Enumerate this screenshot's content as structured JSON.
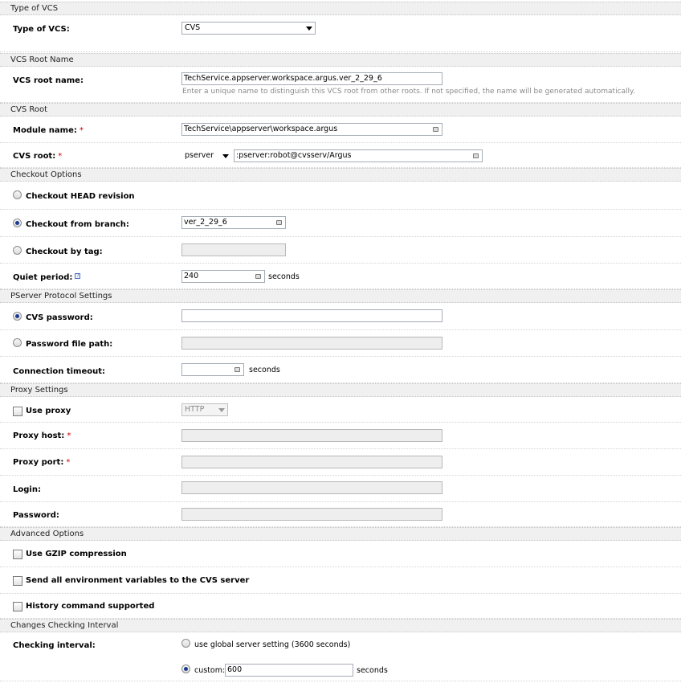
{
  "sections": {
    "type_of_vcs": "Type of VCS",
    "vcs_root_name": "VCS Root Name",
    "cvs_root": "CVS Root",
    "checkout_options": "Checkout Options",
    "pserver": "PServer Protocol Settings",
    "proxy": "Proxy Settings",
    "advanced": "Advanced Options",
    "changes": "Changes Checking Interval"
  },
  "type_of_vcs": {
    "label": "Type of VCS:",
    "value": "CVS"
  },
  "vcs_root_name": {
    "label": "VCS root name:",
    "value": "TechService.appserver.workspace.argus.ver_2_29_6",
    "note": "Enter a unique name to distinguish this VCS root from other roots. If not specified, the name will be generated automatically."
  },
  "module_name": {
    "label": "Module name:",
    "required": "*",
    "value": "TechService\\appserver\\workspace.argus"
  },
  "cvs_root": {
    "label": "CVS root:",
    "required": "*",
    "protocol": "pserver",
    "value": ":pserver:robot@cvsserv/Argus"
  },
  "checkout": {
    "head_label": "Checkout HEAD revision",
    "branch_label": "Checkout from branch:",
    "branch_value": "ver_2_29_6",
    "tag_label": "Checkout by tag:",
    "tag_value": "",
    "quiet_label": "Quiet period:",
    "quiet_help": "?",
    "quiet_value": "240",
    "quiet_unit": "seconds"
  },
  "pserver": {
    "password_label": "CVS password:",
    "password_value": "",
    "file_label": "Password file path:",
    "file_value": "",
    "timeout_label": "Connection timeout:",
    "timeout_value": "",
    "timeout_unit": "seconds"
  },
  "proxy": {
    "use_label": "Use proxy",
    "type_value": "HTTP",
    "host_label": "Proxy host:",
    "port_label": "Proxy port:",
    "required": "*",
    "login_label": "Login:",
    "password_label": "Password:"
  },
  "advanced": {
    "gzip_label": "Use GZIP compression",
    "env_label": "Send all environment variables to the CVS server",
    "history_label": "History command supported"
  },
  "changes": {
    "label": "Checking interval:",
    "global_label": "use global server setting (3600 seconds)",
    "custom_label": "custom:",
    "custom_value": "600",
    "unit": "seconds"
  }
}
